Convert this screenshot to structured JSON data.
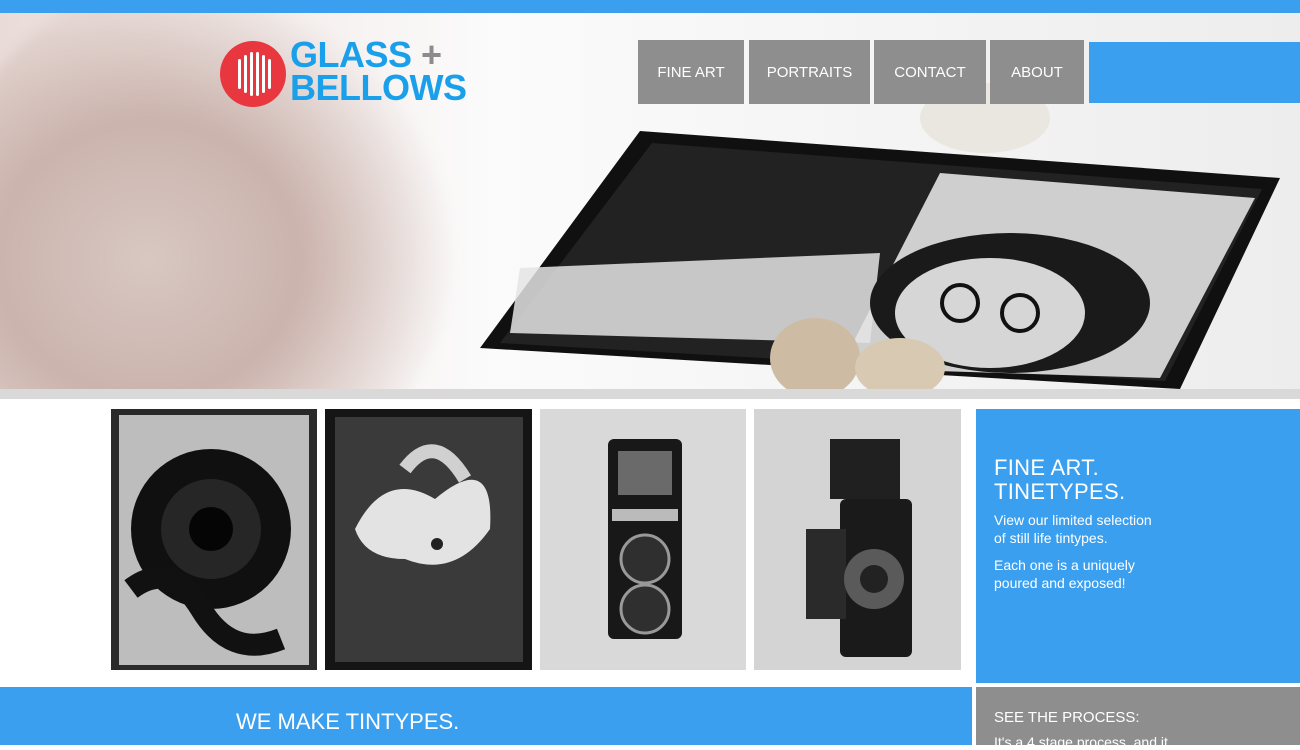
{
  "brand": {
    "line1": "GLASS",
    "plus": "+",
    "line2": "BELLOWS",
    "logo_icon": "striped-circle-icon",
    "colors": {
      "primary": "#1aa0ea",
      "accent": "#e8373e",
      "plus": "#8c8c8c"
    }
  },
  "nav": {
    "items": [
      {
        "label": "FINE ART"
      },
      {
        "label": "PORTRAITS"
      },
      {
        "label": "CONTACT"
      },
      {
        "label": "ABOUT"
      }
    ]
  },
  "gallery": {
    "items": [
      {
        "subject": "gerbera flower tintype"
      },
      {
        "subject": "lily flower tintype"
      },
      {
        "subject": "Yashica-Mat camera tintype"
      },
      {
        "subject": "twin lens camera side view tintype"
      }
    ]
  },
  "fine_art_panel": {
    "title_line1": "FINE ART.",
    "title_line2": "TINETYPES.",
    "text1_line1": "View our limited selection",
    "text1_line2": "of still life tintypes.",
    "text2_line1": "Each one is a uniquely",
    "text2_line2": "poured and exposed!"
  },
  "bottom": {
    "left_title": "WE MAKE TINTYPES.",
    "right_title": "SEE THE PROCESS:",
    "right_text": "It's a 4 stage process, and it"
  },
  "colors": {
    "blue": "#3b9ff0",
    "gray": "#8e8e8e",
    "divider": "#d9d9d9"
  }
}
